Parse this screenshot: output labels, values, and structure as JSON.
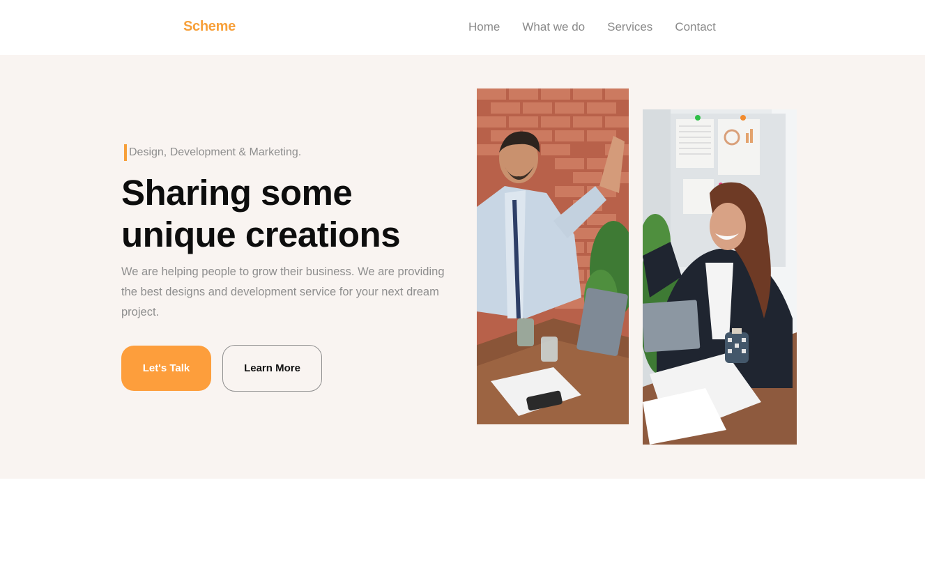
{
  "header": {
    "logo": "Scheme",
    "nav": [
      "Home",
      "What we do",
      "Services",
      "Contact"
    ]
  },
  "hero": {
    "tagline": "Design, Development & Marketing.",
    "title_line1": "Sharing some",
    "title_line2": "unique creations",
    "description": "We are helping people to grow their business. We are providing the best designs and development service for your next dream project.",
    "primary_button": "Let's Talk",
    "secondary_button": "Learn More"
  },
  "colors": {
    "accent": "#f7a03a",
    "hero_background": "#f9f4f1",
    "heading": "#0d0d0d",
    "muted_text": "#8e8e8e"
  },
  "images": {
    "left_photo": "man-high-five-photo",
    "right_photo": "woman-high-five-photo"
  }
}
